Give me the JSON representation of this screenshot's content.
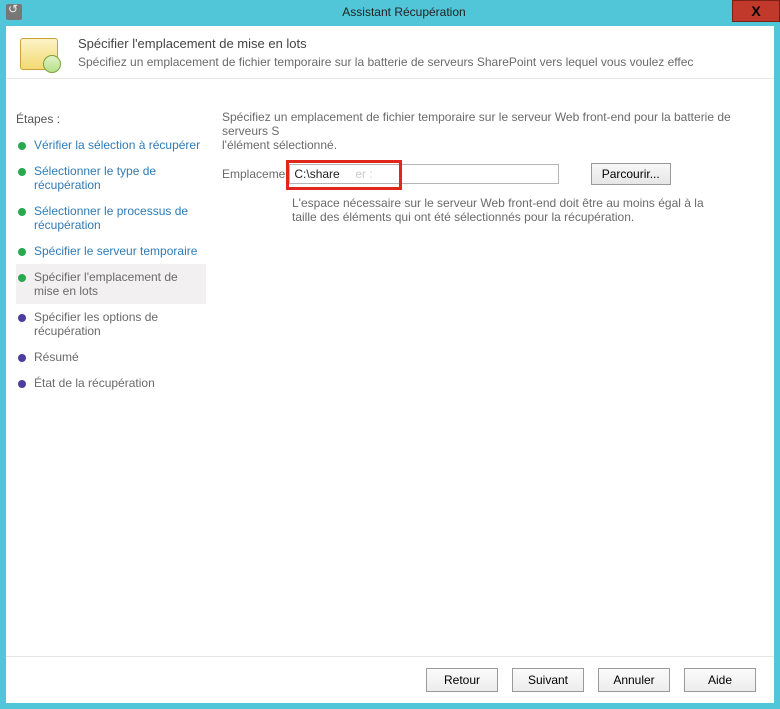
{
  "window": {
    "title": "Assistant Récupération",
    "close_glyph": "X"
  },
  "header": {
    "title": "Spécifier l'emplacement de mise en lots",
    "subtitle": "Spécifiez un emplacement de fichier temporaire sur la batterie de serveurs SharePoint vers lequel vous voulez effec"
  },
  "steps": {
    "heading": "Étapes :",
    "items": [
      {
        "label": "Vérifier la sélection à récupérer",
        "state": "done"
      },
      {
        "label": "Sélectionner le type de récupération",
        "state": "done"
      },
      {
        "label": "Sélectionner le processus de récupération",
        "state": "done"
      },
      {
        "label": "Spécifier le serveur temporaire",
        "state": "done"
      },
      {
        "label": "Spécifier l'emplacement de mise en lots",
        "state": "active"
      },
      {
        "label": "Spécifier les options de récupération",
        "state": "pending"
      },
      {
        "label": "Résumé",
        "state": "pending"
      },
      {
        "label": "État de la récupération",
        "state": "pending"
      }
    ]
  },
  "main": {
    "description": "Spécifiez un emplacement de fichier temporaire sur le serveur Web front-end pour la batterie de serveurs S\nl'élément sélectionné.",
    "field_label_before": "Emplaceme",
    "field_label_after": "er :",
    "path_value": "C:\\share",
    "browse": "Parcourir...",
    "note": "L'espace nécessaire sur le serveur Web front-end doit être au moins égal à la taille des éléments qui ont été sélectionnés pour la récupération."
  },
  "footer": {
    "back": "Retour",
    "next": "Suivant",
    "cancel": "Annuler",
    "help": "Aide"
  }
}
